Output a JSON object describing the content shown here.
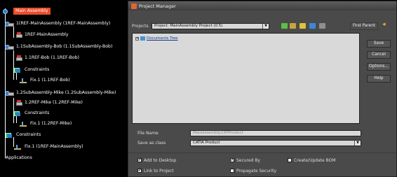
{
  "tree": {
    "root": "Main Assembly",
    "items": [
      "1(REF-MainAssembly (1REF-MainAssembly)",
      "1REF-MainAssembly",
      "1.1SubAssembly-Bob (1.1SubAssembly-Bob)",
      "1.1REF-Bob (1.1REF-Bob)",
      "Constraints",
      "Fix.1 (1.1REF-Bob)",
      "1.2SubAssembly-Mike (1.2SubAssembly-Mike)",
      "1.2REF-Mike (1.2REF-Mike)",
      "Constraints",
      "Fix.1 (1.2REF-Mike)",
      "Constraints",
      "Fix.1 (1REF-MainAssembly)",
      "Applications"
    ]
  },
  "dialog": {
    "title": "Project Manager",
    "project_label": "Projects",
    "project_value": "Project: MainAssembly Project (0.5)",
    "find_parent": "Find Parent",
    "documents_tree": "Documents Tree",
    "buttons": {
      "save": "Save",
      "cancel": "Cancel",
      "options": "Options...",
      "help": "Help"
    },
    "file_name_label": "File Name",
    "file_name_value": "Mainassembly.CATProduct",
    "save_as_label": "Save as class",
    "save_as_value": "CATIA Product",
    "checkboxes": {
      "add_to_desktop": "Add to Desktop",
      "link_to_project": "Link to Project",
      "secured_by": "Secured By",
      "propagate_security": "Propagate Security",
      "create_update_bom": "Create/Update BOM"
    }
  },
  "colors": {
    "selection": "#e84d2a",
    "dialog_bg": "#4a4a4a",
    "tree_bg": "#000000"
  }
}
